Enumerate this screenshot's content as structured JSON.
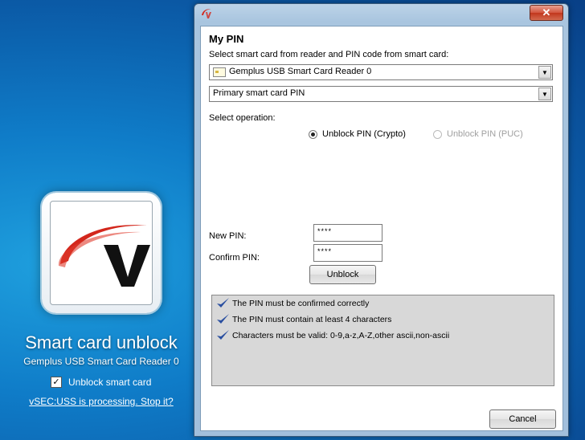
{
  "desktop": {
    "title": "Smart card unblock",
    "subtitle": "Gemplus USB Smart Card Reader 0",
    "checkbox_label": "Unblock smart card",
    "checkbox_checked": true,
    "status_link": "vSEC:USS is processing. Stop it?"
  },
  "window": {
    "close_label": "✕"
  },
  "form": {
    "heading": "My PIN",
    "instruction": "Select smart card from reader and PIN code from smart card:",
    "reader_select": "Gemplus USB Smart Card Reader 0",
    "pin_select": "Primary smart card PIN",
    "operation_label": "Select operation:",
    "radio_crypto": "Unblock PIN (Crypto)",
    "radio_puc": "Unblock PIN (PUC)",
    "new_pin_label": "New PIN:",
    "confirm_pin_label": "Confirm PIN:",
    "new_pin_value": "****",
    "confirm_pin_value": "****",
    "unblock_button": "Unblock",
    "cancel_button": "Cancel"
  },
  "rules": [
    "The PIN must be confirmed correctly",
    "The PIN must contain at least 4 characters",
    "Characters must be valid: 0-9,a-z,A-Z,other ascii,non-ascii"
  ],
  "colors": {
    "accent_red": "#d3271c",
    "check_blue": "#2a4fa0"
  }
}
